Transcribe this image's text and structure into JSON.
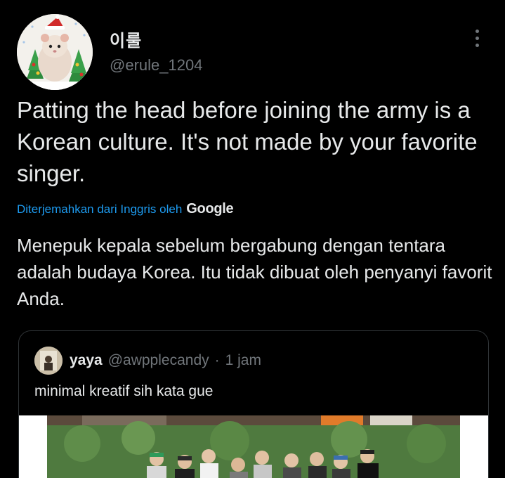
{
  "tweet": {
    "author": {
      "display_name": "이룰",
      "handle": "@erule_1204"
    },
    "text": "Patting the head before joining the army is a Korean culture. It's not made by your favorite singer.",
    "translation": {
      "label": "Diterjemahkan dari Inggris oleh",
      "provider": "Google",
      "text": "Menepuk kepala sebelum bergabung dengan tentara adalah budaya Korea. Itu tidak dibuat oleh penyanyi favorit Anda."
    },
    "more_icon": "more-horizontal-icon",
    "quote": {
      "display_name": "yaya",
      "handle": "@awpplecandy",
      "separator": "·",
      "time": "1 jam",
      "text": "minimal kreatif sih kata gue"
    }
  },
  "colors": {
    "background": "#000000",
    "primary_text": "#e7e9ea",
    "secondary_text": "#71767b",
    "link": "#1d9bf0",
    "border": "#2f3336"
  }
}
